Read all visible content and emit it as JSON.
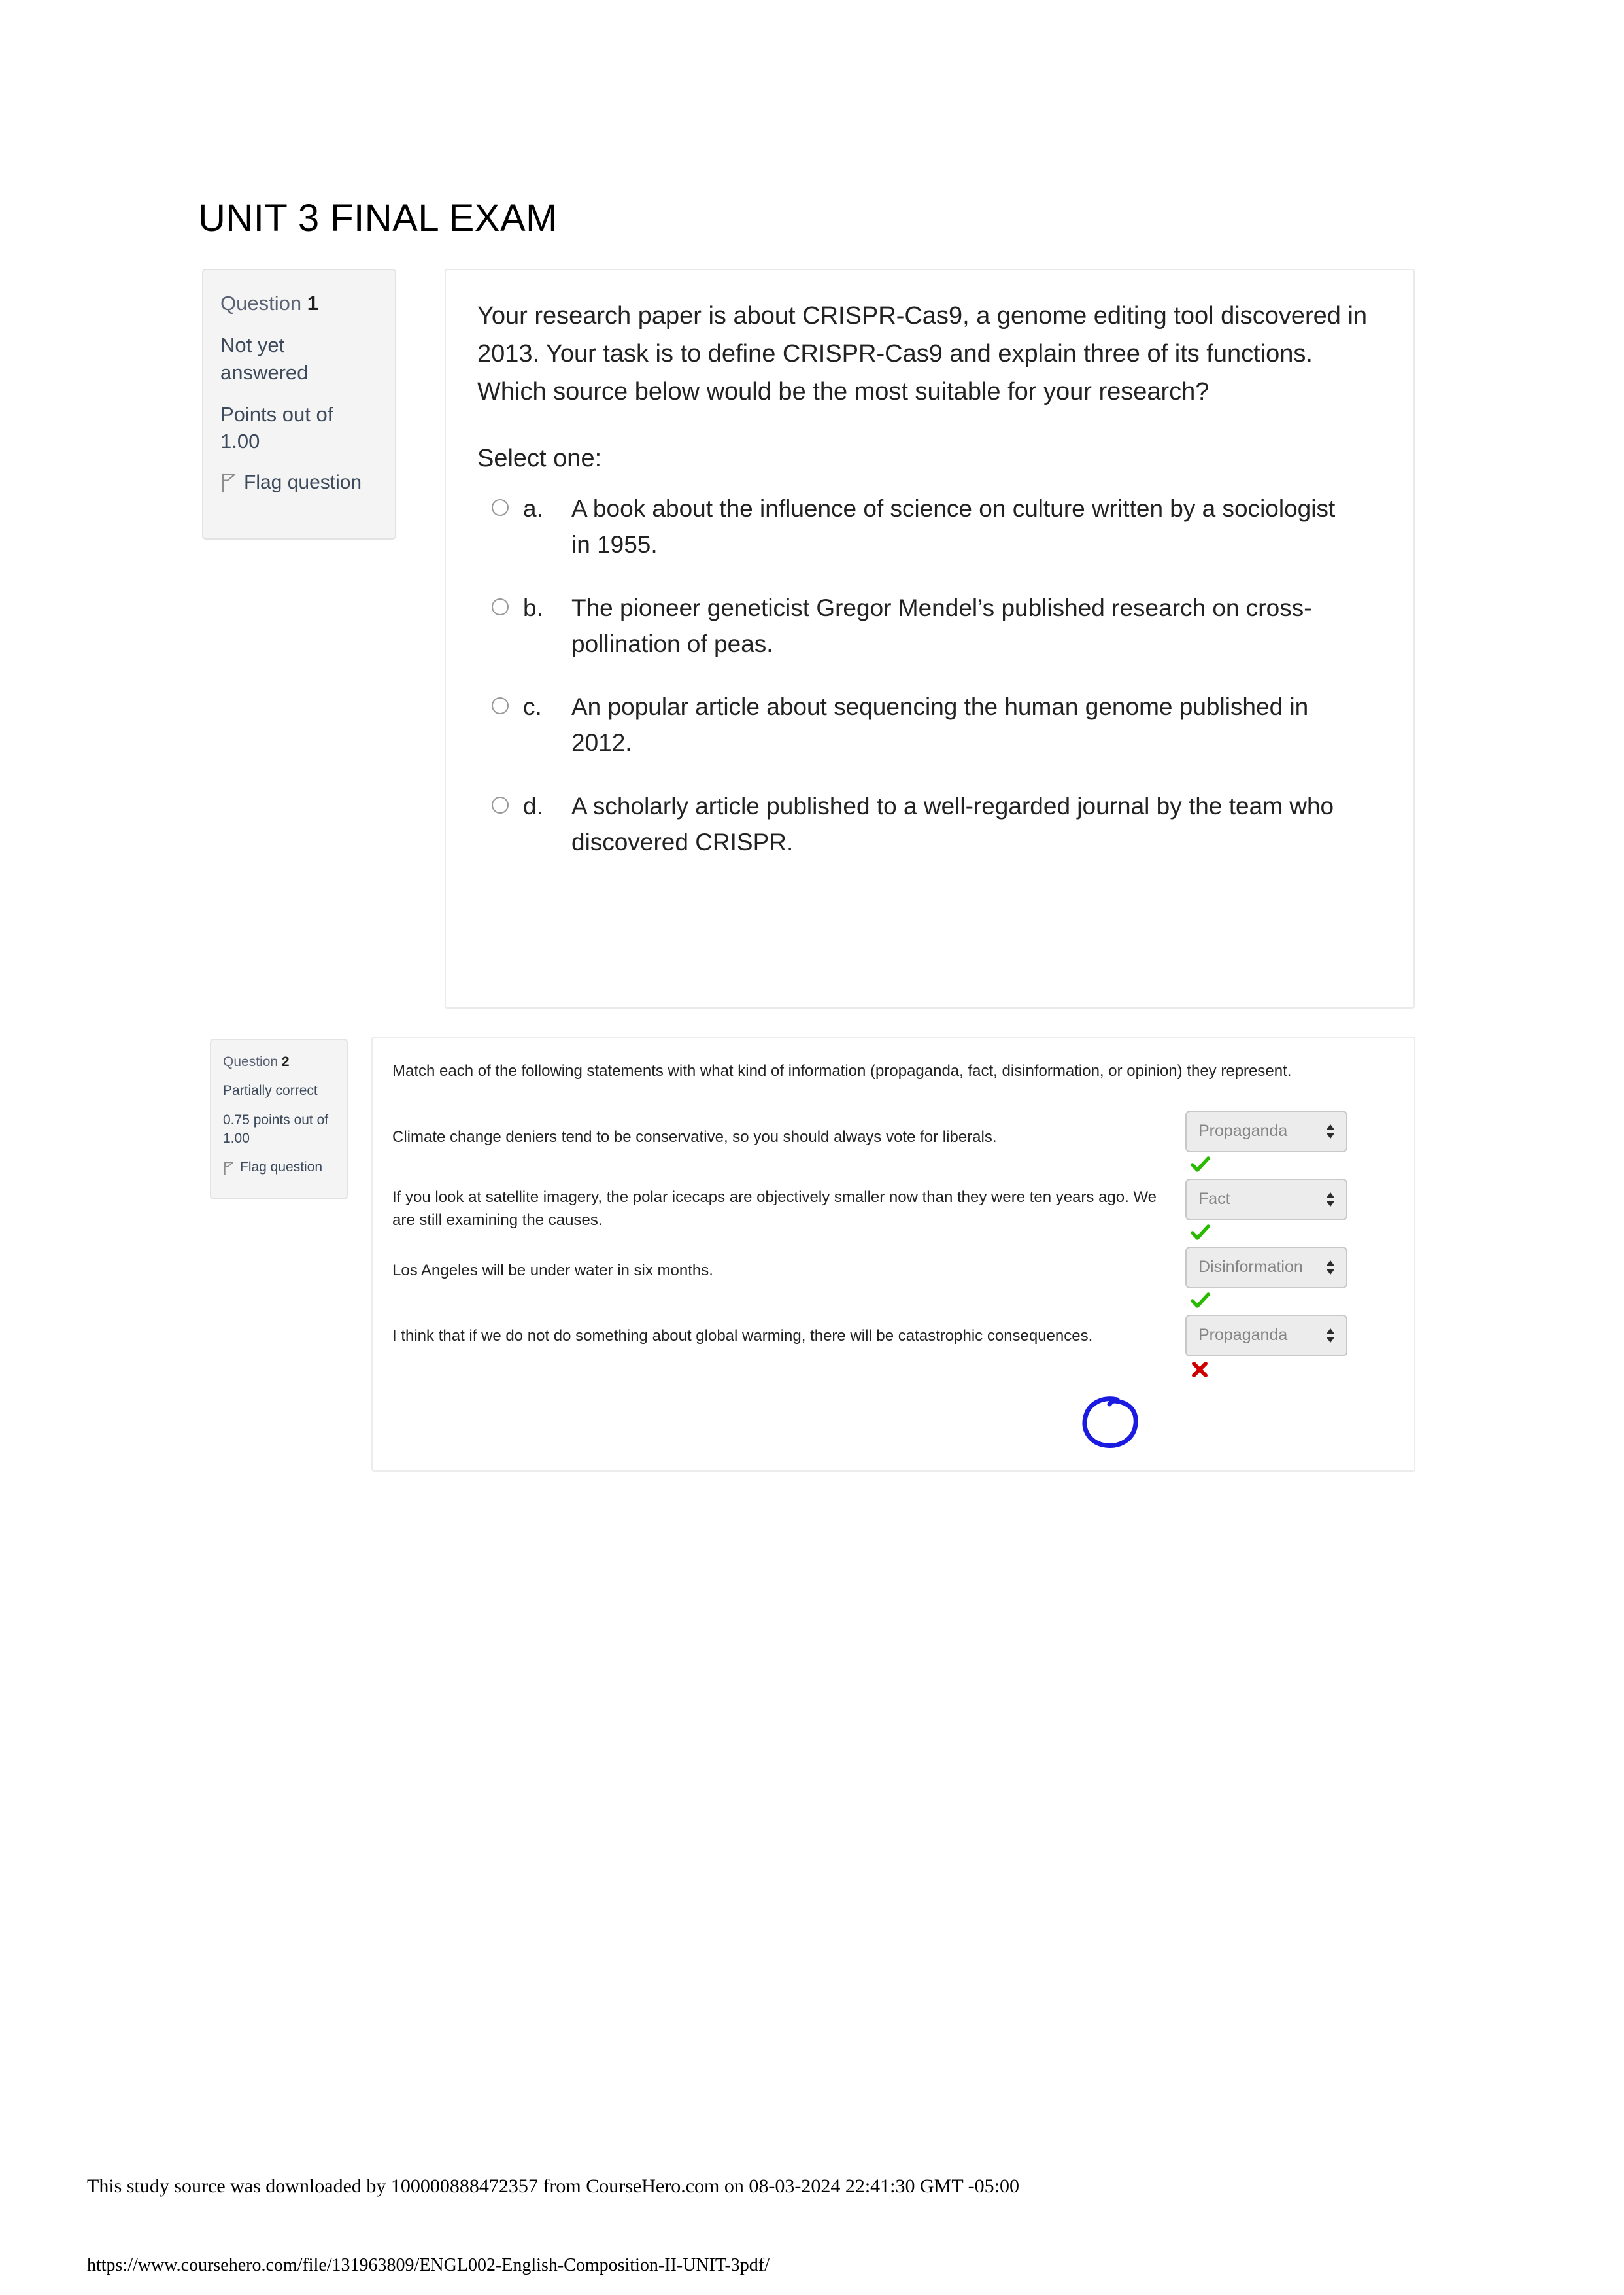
{
  "page": {
    "title": "UNIT 3 FINAL EXAM"
  },
  "question1": {
    "info": {
      "question_word": "Question",
      "number": "1",
      "status": "Not yet answered",
      "points": "Points out of 1.00",
      "flag_label": "Flag question",
      "flag_icon": "flag-outline-icon"
    },
    "stem": "Your research paper is about CRISPR-Cas9, a genome editing tool discovered in 2013. Your task is to define CRISPR-Cas9 and explain three of its functions. Which source below would be the most suitable for your research?",
    "select_instruction": "Select one:",
    "options": [
      {
        "letter": "a.",
        "text": "A book about the influence of science on culture written by a sociologist in 1955.",
        "selected": false
      },
      {
        "letter": "b.",
        "text": "The pioneer geneticist Gregor Mendel’s published research on cross-pollination of peas.",
        "selected": false
      },
      {
        "letter": "c.",
        "text": "An popular article about sequencing the human genome published in 2012.",
        "selected": false
      },
      {
        "letter": "d.",
        "text": "A scholarly article published to a well-regarded journal by the team who discovered CRISPR.",
        "selected": false
      }
    ]
  },
  "question2": {
    "info": {
      "question_word": "Question",
      "number": "2",
      "status": "Partially correct",
      "points": "0.75 points out of 1.00",
      "flag_label": "Flag question",
      "flag_icon": "flag-outline-icon"
    },
    "prompt": "Match each of the following statements with what kind of information (propaganda, fact, disinformation, or opinion) they represent.",
    "matches": [
      {
        "statement": "Climate change deniers tend to be conservative, so you should always vote for liberals.",
        "selected_option": "Propaganda",
        "result": "correct",
        "result_icon": "green-check-icon"
      },
      {
        "statement": "If you look at satellite imagery, the polar icecaps are objectively smaller now than they were ten years ago. We are still examining the causes.",
        "selected_option": "Fact",
        "result": "correct",
        "result_icon": "green-check-icon"
      },
      {
        "statement": "Los Angeles will be under water in six months.",
        "selected_option": "Disinformation",
        "result": "correct",
        "result_icon": "green-check-icon"
      },
      {
        "statement": "I think that if we do not do something about global warming, there will be catastrophic consequences.",
        "selected_option": "Propaganda",
        "result": "incorrect",
        "result_icon": "red-cross-icon"
      }
    ],
    "dropdown_arrows_icon": "updown-chevron-icon",
    "annotation": {
      "type": "hand-drawn-circle",
      "color": "#1a1ae0"
    }
  },
  "footer": {
    "download_note": "This study source was downloaded by 100000888472357 from CourseHero.com on 08-03-2024 22:41:30 GMT -05:00",
    "url": "https://www.coursehero.com/file/131963809/ENGL002-English-Composition-II-UNIT-3pdf/"
  },
  "colors": {
    "correct": "#2aba00",
    "incorrect": "#cc0000",
    "annotation": "#1a1ae0",
    "panel_bg": "#f4f4f4",
    "dropdown_bg": "#ececec"
  }
}
